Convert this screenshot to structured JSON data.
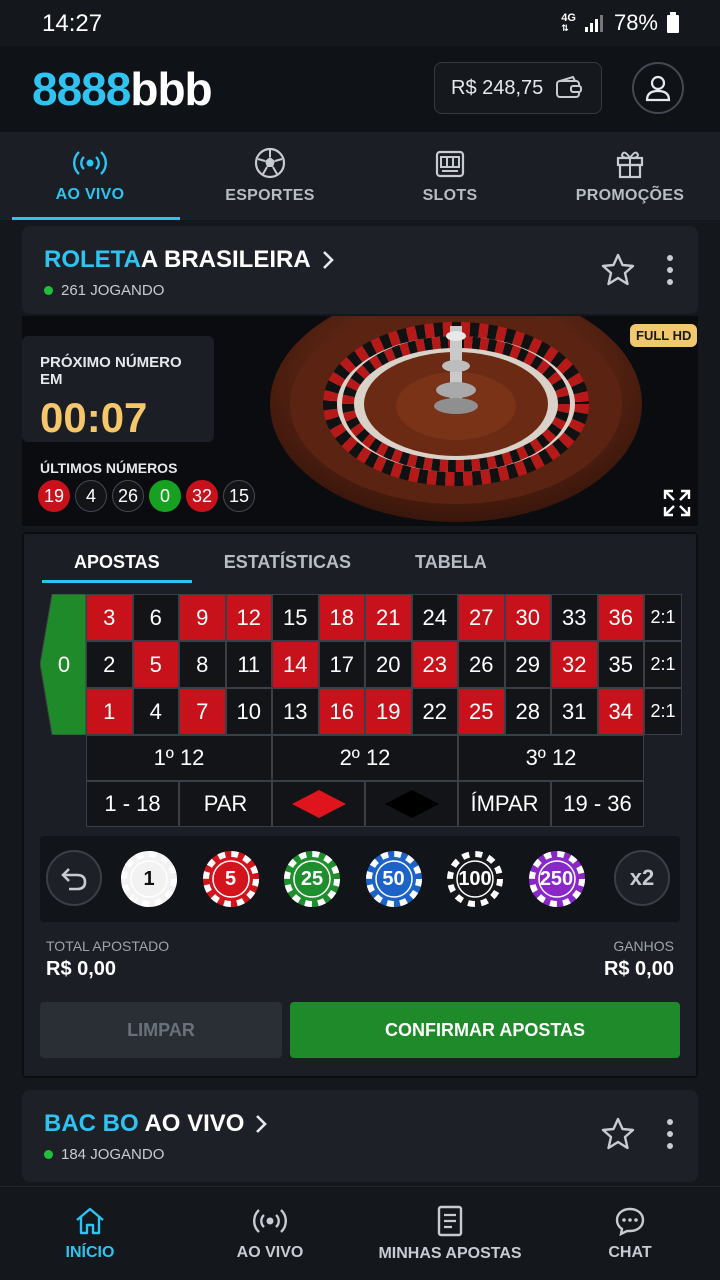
{
  "status_bar": {
    "time": "14:27",
    "network": "4G",
    "battery": "78%"
  },
  "header": {
    "logo_a": "8888",
    "logo_b": "bbb",
    "balance": "R$ 248,75"
  },
  "main_nav": [
    {
      "label": "AO VIVO",
      "icon": "live-broadcast-icon",
      "active": true
    },
    {
      "label": "ESPORTES",
      "icon": "soccer-ball-icon",
      "active": false
    },
    {
      "label": "SLOTS",
      "icon": "slot-machine-icon",
      "active": false
    },
    {
      "label": "PROMOÇÕES",
      "icon": "gift-icon",
      "active": false
    }
  ],
  "game": {
    "title_accent": "ROLETA",
    "title_rest": "A BRASILEIRA",
    "players": "261 JOGANDO",
    "badge": "FULL HD",
    "timer_label": "PRÓXIMO NÚMERO EM",
    "timer_value": "00:07",
    "last_label": "ÚLTIMOS NÚMEROS",
    "last_numbers": [
      {
        "n": "19",
        "c": "r"
      },
      {
        "n": "4",
        "c": "b"
      },
      {
        "n": "26",
        "c": "b"
      },
      {
        "n": "0",
        "c": "g"
      },
      {
        "n": "32",
        "c": "r"
      },
      {
        "n": "15",
        "c": "b"
      }
    ]
  },
  "bet_tabs": {
    "apostas": "APOSTAS",
    "estatisticas": "ESTATÍSTICAS",
    "tabela": "TABELA"
  },
  "table": {
    "zero": "0",
    "rows": [
      [
        {
          "n": "3",
          "c": "red"
        },
        {
          "n": "6",
          "c": "black"
        },
        {
          "n": "9",
          "c": "red"
        },
        {
          "n": "12",
          "c": "red"
        },
        {
          "n": "15",
          "c": "black"
        },
        {
          "n": "18",
          "c": "red"
        },
        {
          "n": "21",
          "c": "red"
        },
        {
          "n": "24",
          "c": "black"
        },
        {
          "n": "27",
          "c": "red"
        },
        {
          "n": "30",
          "c": "red"
        },
        {
          "n": "33",
          "c": "black"
        },
        {
          "n": "36",
          "c": "red"
        }
      ],
      [
        {
          "n": "2",
          "c": "black"
        },
        {
          "n": "5",
          "c": "red"
        },
        {
          "n": "8",
          "c": "black"
        },
        {
          "n": "11",
          "c": "black"
        },
        {
          "n": "14",
          "c": "red"
        },
        {
          "n": "17",
          "c": "black"
        },
        {
          "n": "20",
          "c": "black"
        },
        {
          "n": "23",
          "c": "red"
        },
        {
          "n": "26",
          "c": "black"
        },
        {
          "n": "29",
          "c": "black"
        },
        {
          "n": "32",
          "c": "red"
        },
        {
          "n": "35",
          "c": "black"
        }
      ],
      [
        {
          "n": "1",
          "c": "red"
        },
        {
          "n": "4",
          "c": "black"
        },
        {
          "n": "7",
          "c": "red"
        },
        {
          "n": "10",
          "c": "black"
        },
        {
          "n": "13",
          "c": "black"
        },
        {
          "n": "16",
          "c": "red"
        },
        {
          "n": "19",
          "c": "red"
        },
        {
          "n": "22",
          "c": "black"
        },
        {
          "n": "25",
          "c": "red"
        },
        {
          "n": "28",
          "c": "black"
        },
        {
          "n": "31",
          "c": "black"
        },
        {
          "n": "34",
          "c": "red"
        }
      ]
    ],
    "column_bet": "2:1",
    "dozens": [
      "1º 12",
      "2º 12",
      "3º 12"
    ],
    "outside": {
      "low": "1 - 18",
      "even": "PAR",
      "odd": "ÍMPAR",
      "high": "19 - 36"
    }
  },
  "chips": [
    {
      "value": "1",
      "color": "#f2f2f2",
      "text": "#111111"
    },
    {
      "value": "5",
      "color": "#d3141c",
      "text": "#ffffff"
    },
    {
      "value": "25",
      "color": "#1f8f2e",
      "text": "#ffffff"
    },
    {
      "value": "50",
      "color": "#1c63c7",
      "text": "#ffffff"
    },
    {
      "value": "100",
      "color": "#15171b",
      "text": "#ffffff"
    },
    {
      "value": "250",
      "color": "#8a27c9",
      "text": "#ffffff"
    }
  ],
  "double_label": "x2",
  "totals": {
    "staked_label": "TOTAL APOSTADO",
    "staked_value": "R$ 0,00",
    "win_label": "GANHOS",
    "win_value": "R$ 0,00"
  },
  "buttons": {
    "clear": "LIMPAR",
    "confirm": "CONFIRMAR APOSTAS"
  },
  "game2": {
    "title_accent": "BAC BO",
    "title_rest": "AO VIVO",
    "players": "184 JOGANDO"
  },
  "bottom_nav": [
    {
      "label": "INÍCIO",
      "icon": "home-icon",
      "active": true
    },
    {
      "label": "AO VIVO",
      "icon": "live-broadcast-icon",
      "active": false
    },
    {
      "label": "MINHAS APOSTAS",
      "icon": "bet-slip-icon",
      "active": false
    },
    {
      "label": "CHAT",
      "icon": "chat-bubble-icon",
      "active": false
    }
  ],
  "colors": {
    "accent": "#2ec3f0",
    "red": "#c8121b",
    "green": "#1f8a2a",
    "gold": "#f5c76a"
  }
}
